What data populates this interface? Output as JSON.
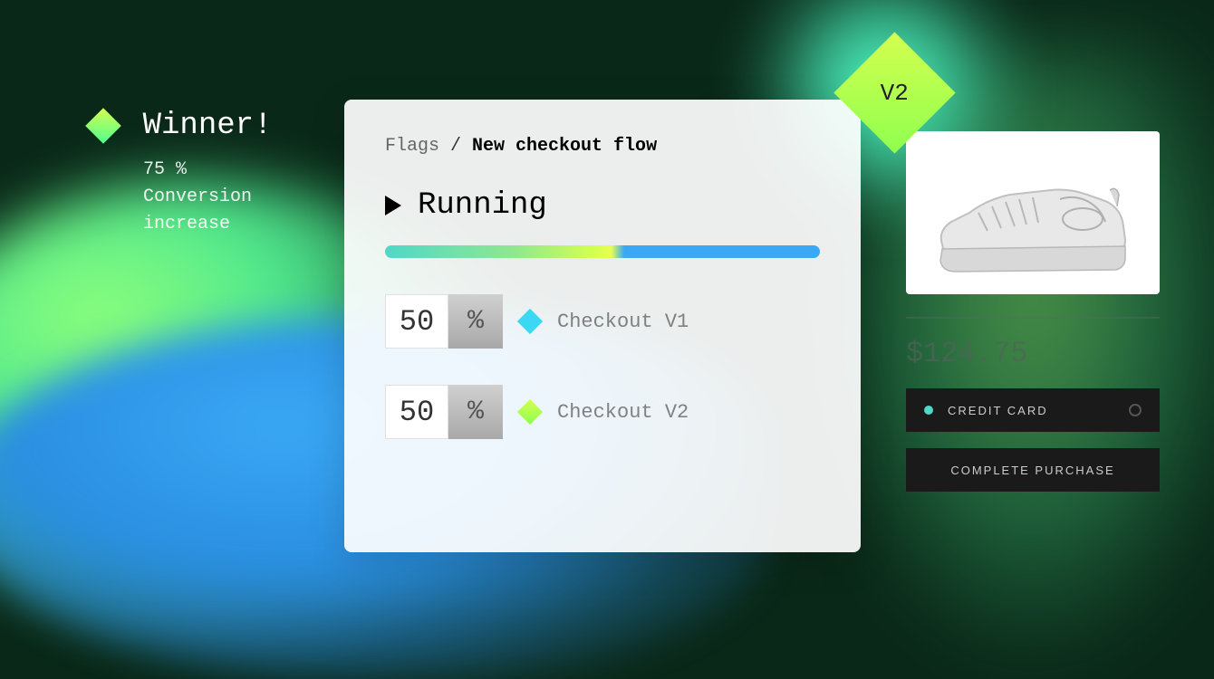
{
  "winner": {
    "title": "Winner!",
    "metric": "75 %",
    "metric_label_1": "Conversion",
    "metric_label_2": "increase"
  },
  "breadcrumb": {
    "parent": "Flags",
    "separator": " / ",
    "current": "New checkout flow"
  },
  "status": {
    "label": "Running"
  },
  "variants": [
    {
      "value": "50",
      "unit": "%",
      "label": "Checkout V1"
    },
    {
      "value": "50",
      "unit": "%",
      "label": "Checkout V2"
    }
  ],
  "badge": {
    "text": "V2"
  },
  "checkout": {
    "price": "$124.75",
    "payment_method": "CREDIT CARD",
    "purchase_button": "COMPLETE PURCHASE"
  }
}
